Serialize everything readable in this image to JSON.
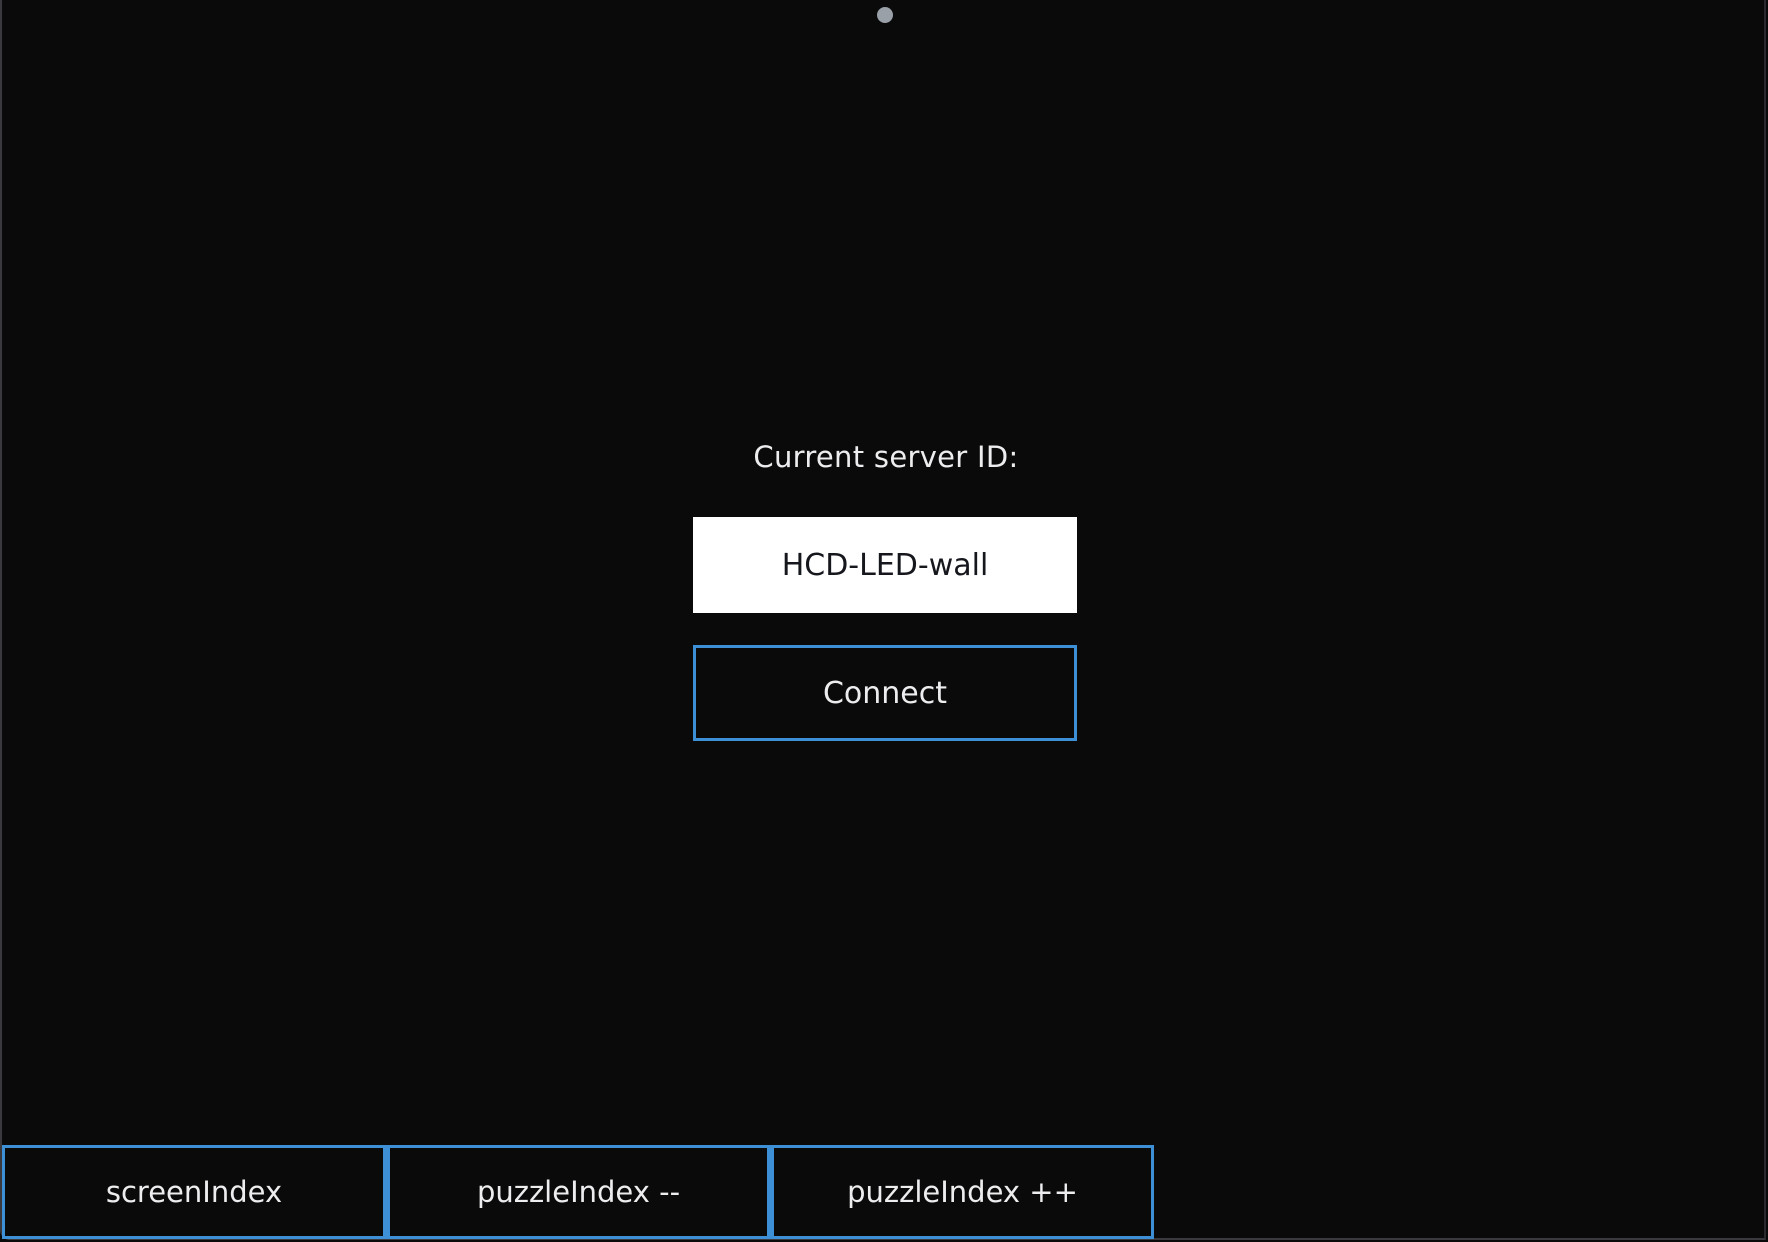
{
  "page": {
    "server_label": "Current server ID:",
    "server_id_value": "HCD-LED-wall",
    "connect_label": "Connect"
  },
  "bottom_bar": {
    "buttons": [
      {
        "label": "screenIndex"
      },
      {
        "label": "puzzleIndex --"
      },
      {
        "label": "puzzleIndex ++"
      }
    ]
  },
  "colors": {
    "background": "#0a0a0b",
    "accent_border": "#3d8fd6",
    "input_background": "#ffffff",
    "text": "#ededef"
  }
}
